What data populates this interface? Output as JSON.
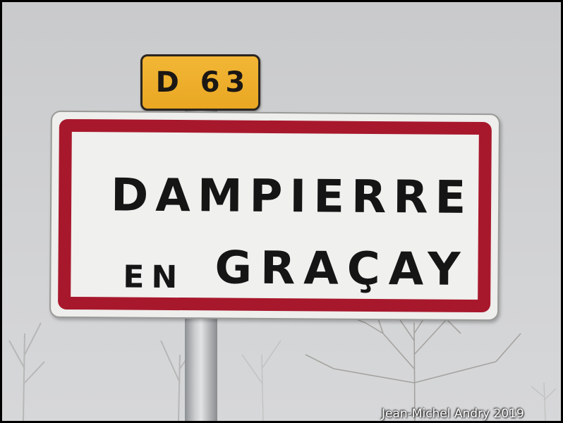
{
  "road_plate": {
    "text": "D 63",
    "color": "#eeaf2c"
  },
  "town_sign": {
    "line_1": "DAMPIERRE",
    "line_2_prefix": "EN",
    "line_2_name": "GRAÇAY",
    "border_color": "#a8182c",
    "background_color": "#f0f0ee"
  },
  "photo_credit": "Jean-Michel Andry 2019"
}
